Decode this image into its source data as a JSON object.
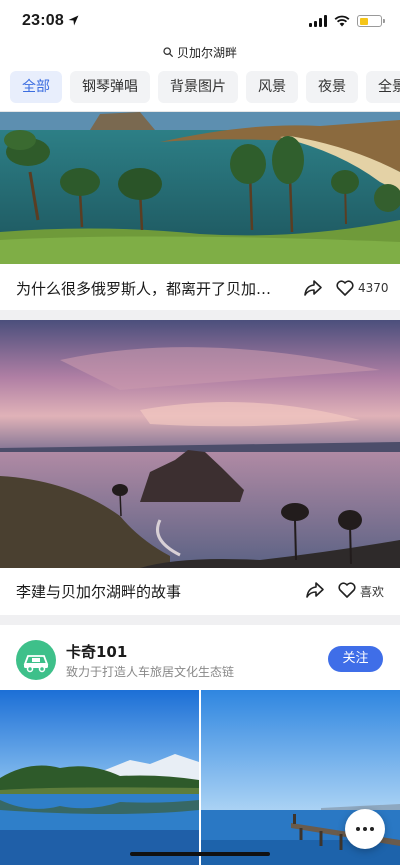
{
  "status": {
    "time": "23:08"
  },
  "search": {
    "query": "贝加尔湖畔"
  },
  "tabs": [
    {
      "label": "全部",
      "active": true
    },
    {
      "label": "钢琴弹唱",
      "active": false
    },
    {
      "label": "背景图片",
      "active": false
    },
    {
      "label": "风景",
      "active": false
    },
    {
      "label": "夜景",
      "active": false
    },
    {
      "label": "全景",
      "active": false
    }
  ],
  "cards": [
    {
      "title": "为什么很多俄罗斯人，都离开了贝加…",
      "likes": "4370"
    },
    {
      "title": "李建与贝加尔湖畔的故事",
      "likes": "喜欢"
    }
  ],
  "author": {
    "name": "卡奇101",
    "description": "致力于打造人车旅居文化生态链",
    "follow_label": "关注"
  },
  "colors": {
    "accent": "#3f6ee8",
    "tab_active_bg": "#e8eefc",
    "tab_active_text": "#3b6de0",
    "avatar_bg": "#3ec08a"
  },
  "icons": [
    "location-arrow-icon",
    "signal-icon",
    "wifi-icon",
    "battery-icon",
    "search-icon",
    "share-icon",
    "heart-icon",
    "more-icon"
  ]
}
